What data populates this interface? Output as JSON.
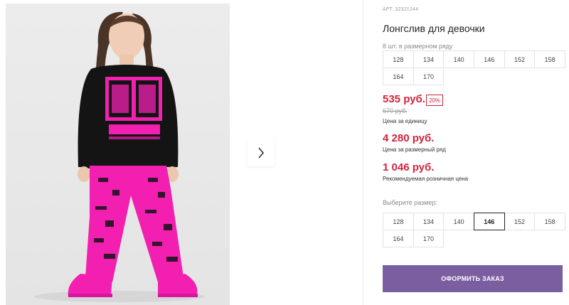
{
  "product": {
    "sku": "АРТ. 32321244",
    "title": "Лонгслив для девочки"
  },
  "size_row": {
    "caption": "8 шт. в размерном ряду",
    "sizes": [
      "128",
      "134",
      "140",
      "146",
      "152",
      "158",
      "164",
      "170"
    ]
  },
  "pricing": {
    "unit_price": "535 руб.",
    "discount_badge": "20%",
    "old_price": "670 руб.",
    "unit_note": "Цена за единицу",
    "row_price": "4 280 руб.",
    "row_note": "Цена за размерный ряд",
    "retail_price": "1 046 руб.",
    "retail_note": "Рекомендуемая розничная цена"
  },
  "size_select": {
    "caption": "Выберите размер:",
    "sizes": [
      "128",
      "134",
      "140",
      "146",
      "152",
      "158",
      "164",
      "170"
    ],
    "selected": "146"
  },
  "order": {
    "button_label": "ОФОРМИТЬ ЗАКАЗ"
  },
  "colors": {
    "accent_red": "#d0233c",
    "order_button": "#7b5ea0",
    "pink": "#f21fb0"
  },
  "gallery": {
    "next_icon": "chevron-right-icon"
  }
}
